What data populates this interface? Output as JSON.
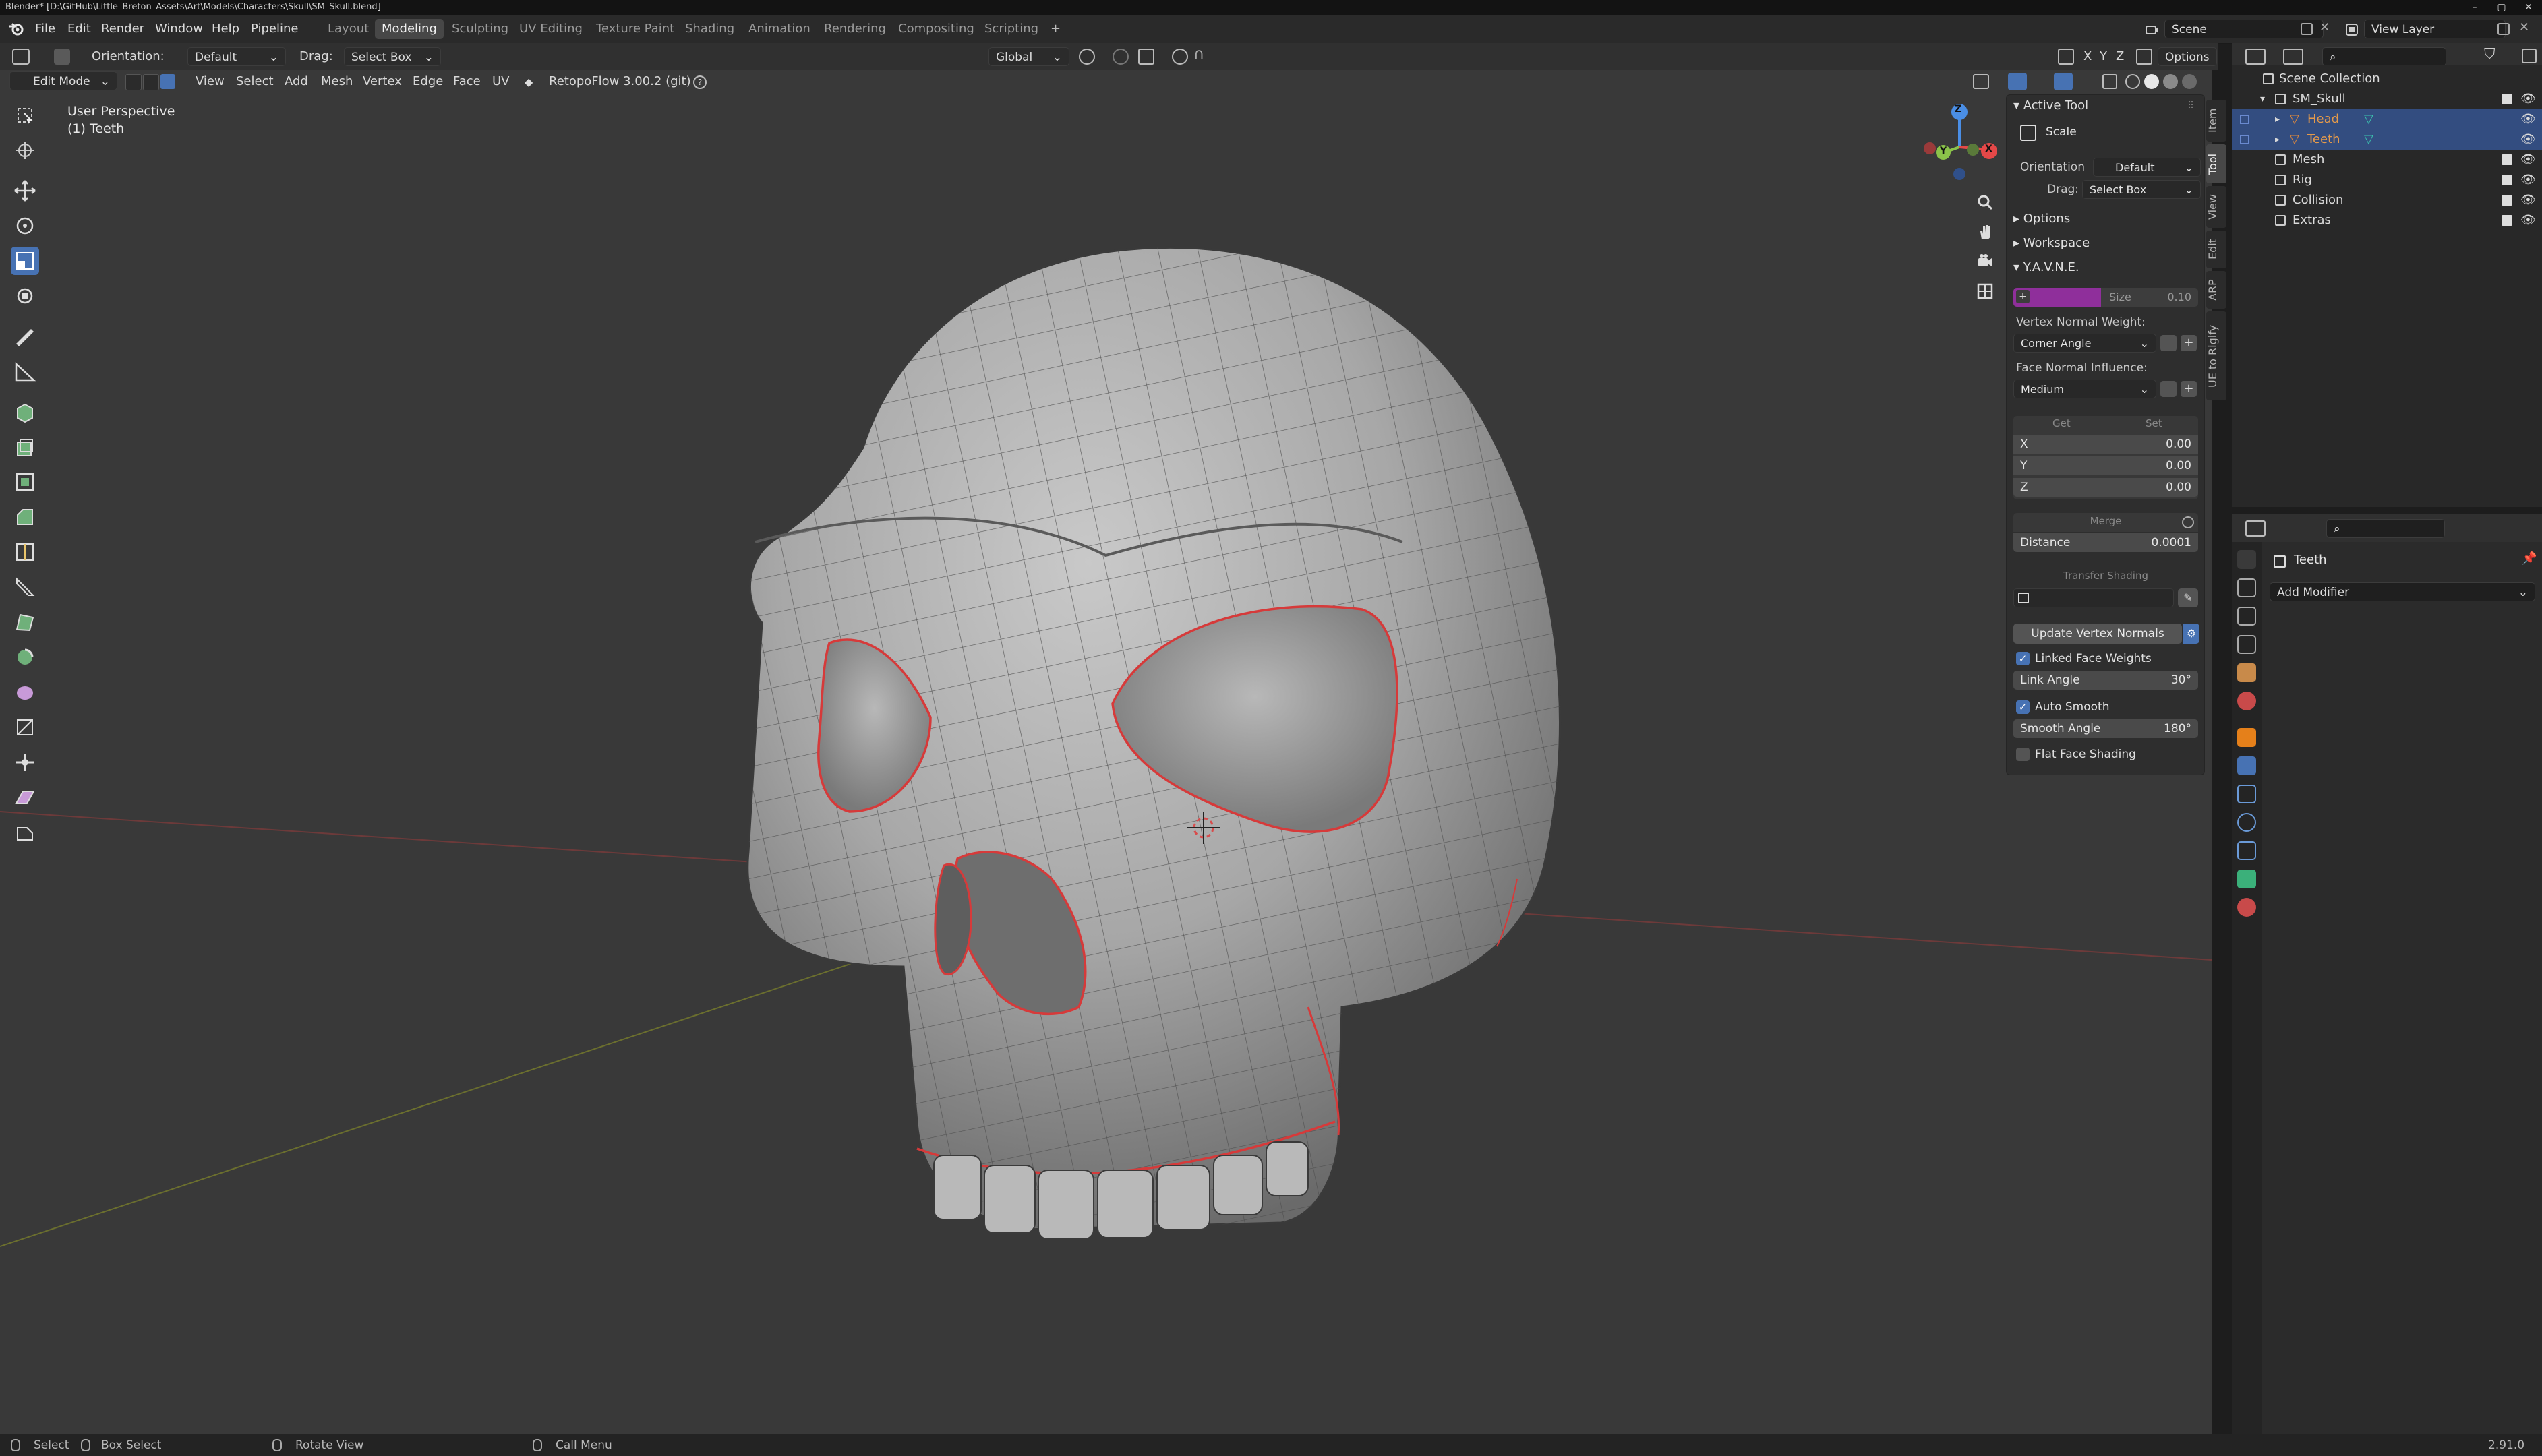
{
  "titlebar": {
    "title": "Blender* [D:\\GitHub\\Little_Breton_Assets\\Art\\Models\\Characters\\Skull\\SM_Skull.blend]",
    "min": "–",
    "max": "▢",
    "close": "✕"
  },
  "menubar": {
    "items": [
      "File",
      "Edit",
      "Render",
      "Window",
      "Help",
      "Pipeline"
    ],
    "workspaces": [
      "Layout",
      "Modeling",
      "Sculpting",
      "UV Editing",
      "Texture Paint",
      "Shading",
      "Animation",
      "Rendering",
      "Compositing",
      "Scripting"
    ],
    "active_workspace": "Modeling",
    "add_workspace": "+",
    "scene": "Scene",
    "view_layer": "View Layer"
  },
  "toolheader": {
    "orientation_label": "Orientation:",
    "orientation_value": "Default",
    "drag_label": "Drag:",
    "drag_value": "Select Box",
    "transform_orientation": "Global",
    "axes": [
      "X",
      "Y",
      "Z"
    ],
    "options": "Options"
  },
  "viewheader": {
    "mode": "Edit Mode",
    "menus": [
      "View",
      "Select",
      "Add",
      "Mesh",
      "Vertex",
      "Edge",
      "Face",
      "UV"
    ],
    "addon": "RetopoFlow 3.00.2 (git)"
  },
  "viewport": {
    "perspective": "User Perspective",
    "object": "(1) Teeth"
  },
  "gizmo": {
    "x": "X",
    "y": "Y",
    "z": "Z",
    "colors": {
      "x": "#e54848",
      "y": "#8bc34a",
      "z": "#4a8ee5"
    }
  },
  "npanel": {
    "active_tool_title": "Active Tool",
    "tool_name": "Scale",
    "orientation_label": "Orientation",
    "orientation_value": "Default",
    "drag_label": "Drag:",
    "drag_value": "Select Box",
    "options_title": "Options",
    "workspace_title": "Workspace",
    "yavne_title": "Y.A.V.N.E.",
    "size_label": "Size",
    "size_value": "0.10",
    "vnw_label": "Vertex Normal Weight:",
    "vnw_value": "Corner Angle",
    "fni_label": "Face Normal Influence:",
    "fni_value": "Medium",
    "get_label": "Get",
    "set_label": "Set",
    "x_label": "X",
    "x_value": "0.00",
    "y_label": "Y",
    "y_value": "0.00",
    "z_label": "Z",
    "z_value": "0.00",
    "merge_label": "Merge",
    "distance_label": "Distance",
    "distance_value": "0.0001",
    "transfer_label": "Transfer Shading",
    "update_btn": "Update Vertex Normals",
    "linked_face_weights": "Linked Face Weights",
    "link_angle_label": "Link Angle",
    "link_angle_value": "30°",
    "auto_smooth": "Auto Smooth",
    "smooth_angle_label": "Smooth Angle",
    "smooth_angle_value": "180°",
    "flat_face_shading": "Flat Face Shading",
    "accent": "#8f2f9b"
  },
  "vtabs": [
    "Item",
    "Tool",
    "View",
    "Edit",
    "ARP",
    "UE to Rigify"
  ],
  "outliner": {
    "root": "Scene Collection",
    "rows": [
      {
        "name": "SM_Skull"
      },
      {
        "name": "Head"
      },
      {
        "name": "Teeth"
      },
      {
        "name": "Mesh"
      },
      {
        "name": "Rig"
      },
      {
        "name": "Collision"
      },
      {
        "name": "Extras"
      }
    ]
  },
  "properties": {
    "object_name": "Teeth",
    "add_modifier": "Add Modifier"
  },
  "statusbar": {
    "select": "Select",
    "box_select": "Box Select",
    "rotate_view": "Rotate View",
    "call_menu": "Call Menu",
    "version": "2.91.0"
  }
}
